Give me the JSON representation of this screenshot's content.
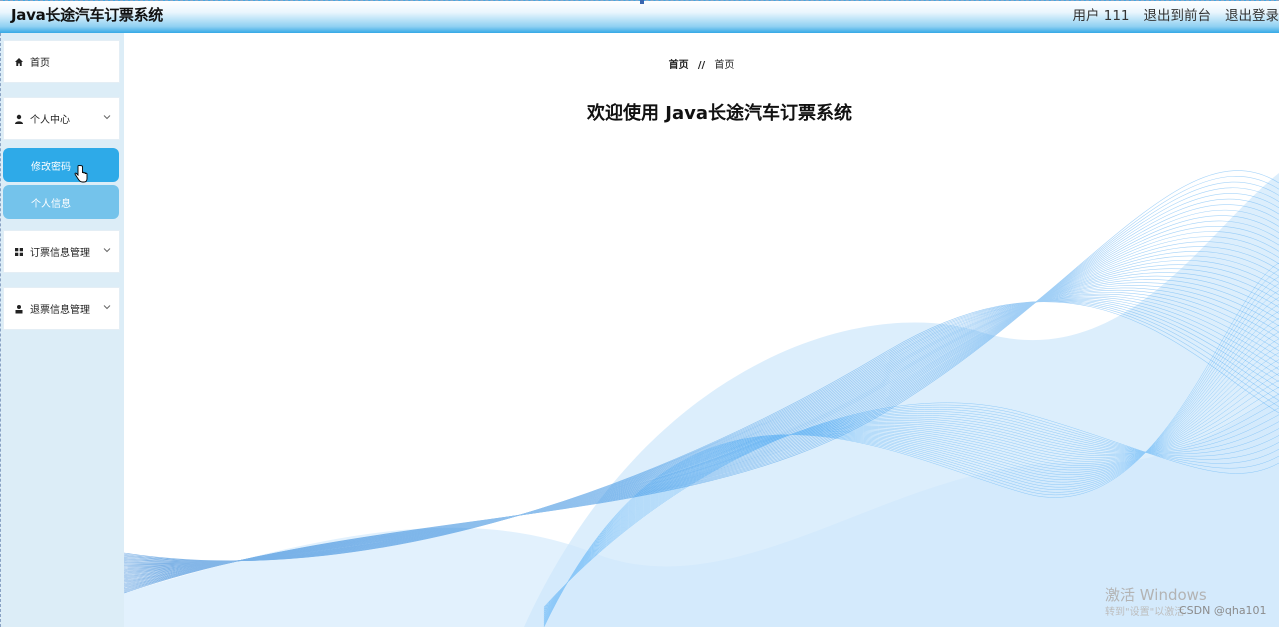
{
  "header": {
    "title": "Java长途汽车订票系统",
    "user_label": "用户 111",
    "exit_front_label": "退出到前台",
    "logout_label": "退出登录"
  },
  "sidebar": {
    "items": [
      {
        "label": "首页",
        "icon": "home-icon"
      },
      {
        "label": "个人中心",
        "icon": "user-icon",
        "expanded": true,
        "children": [
          {
            "label": "修改密码",
            "active": true
          },
          {
            "label": "个人信息",
            "active": false
          }
        ]
      },
      {
        "label": "订票信息管理",
        "icon": "grid-icon"
      },
      {
        "label": "退票信息管理",
        "icon": "person-icon"
      }
    ]
  },
  "main": {
    "breadcrumb": {
      "home": "首页",
      "separator": "//",
      "current": "首页"
    },
    "welcome": "欢迎使用 Java长途汽车订票系统"
  },
  "overlay": {
    "activate_windows": "激活 Windows",
    "activate_hint": "转到\"设置\"以激活",
    "csdn": "CSDN @qha101"
  },
  "colors": {
    "accent": "#2eaae8",
    "sub_item": "#74c3eb",
    "sidebar_bg": "#dcedf7",
    "wave": "#1e88e5"
  }
}
